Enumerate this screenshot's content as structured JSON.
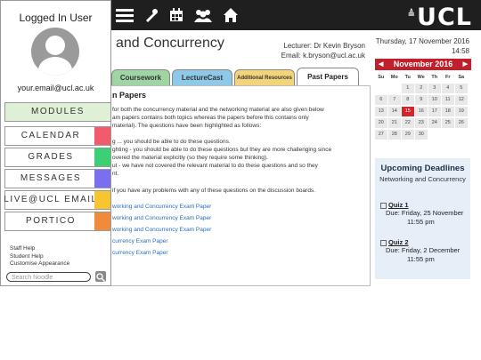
{
  "topbar": {
    "logo": "UCL",
    "logo_mark": "≜",
    "icons": [
      "menu-icon",
      "tool-icon",
      "calendar-icon",
      "people-icon",
      "home-icon"
    ]
  },
  "main": {
    "title": "and Concurrency",
    "lecturer": "Lecturer: Dr Kevin Bryson",
    "email": "Email: k.bryson@ucl.ac.uk"
  },
  "tabs": {
    "coursework": "Coursework",
    "lecturecast": "LectureCast",
    "additional": "Additional Resources",
    "past_papers": "Past Papers"
  },
  "content": {
    "heading": "n Papers",
    "lines": [
      "for both the concurrency material and the networking material are also given below",
      "am papers contains both topics whereas the papers before this contains only",
      "material). The questions have been highlighted as follows:",
      "g ... you should be able to do these questions.",
      "ghting - you should be able to do these questions but they are more challenging since",
      "overed the material explicitly (so they require some thinking).",
      "ut - we have not covered the relevant material to do these questions and so they",
      "nt.",
      "if you have any problems with any of these questions on the discussion boards."
    ],
    "links": [
      "working and Concurrency Exam Paper",
      "working and Concurrency Exam Paper",
      "working and Concurrency Exam Paper",
      "currency Exam Paper",
      "currency Exam Paper"
    ]
  },
  "sidebar": {
    "title": "Logged In User",
    "email": "your.email@ucl.ac.uk",
    "menu": [
      {
        "label": "MODULES",
        "color": ""
      },
      {
        "label": "CALENDAR",
        "color": "#f25b6b"
      },
      {
        "label": "GRADES",
        "color": "#3ccf75"
      },
      {
        "label": "MESSAGES",
        "color": "#7b6ff0"
      },
      {
        "label": "LIVE@UCL EMAIL",
        "color": "#f7c531"
      },
      {
        "label": "PORTICO",
        "color": "#f08a3c"
      }
    ],
    "links": [
      "Staff Help",
      "Student Help",
      "Customise Appearance"
    ],
    "search_placeholder": "Search Noodle"
  },
  "calendar": {
    "date": "Thursday, 17 November 2016",
    "time": "14:58",
    "month": "November 2016",
    "weekdays": [
      "Su",
      "Mo",
      "Tu",
      "We",
      "Th",
      "Fr",
      "Sa"
    ],
    "days": [
      "",
      "",
      "1",
      "2",
      "3",
      "4",
      "5",
      "6",
      "7",
      "8",
      "9",
      "10",
      "11",
      "12",
      "13",
      "14",
      "15",
      "16",
      "17",
      "18",
      "19",
      "20",
      "21",
      "22",
      "23",
      "24",
      "25",
      "26",
      "27",
      "28",
      "29",
      "30",
      ""
    ],
    "highlighted": "15"
  },
  "deadlines": {
    "title": "Upcoming Deadlines",
    "subtitle": "Networking and Concurrency",
    "quizzes": [
      {
        "name": "Quiz 1",
        "due": "Due: Friday, 25 November",
        "time": "11:55 pm"
      },
      {
        "name": "Quiz 2",
        "due": "Due: Friday, 2 December",
        "time": "11:55 pm"
      }
    ]
  },
  "colors": {
    "accent": "#c0202b",
    "topbar": "#1f1f1f"
  }
}
